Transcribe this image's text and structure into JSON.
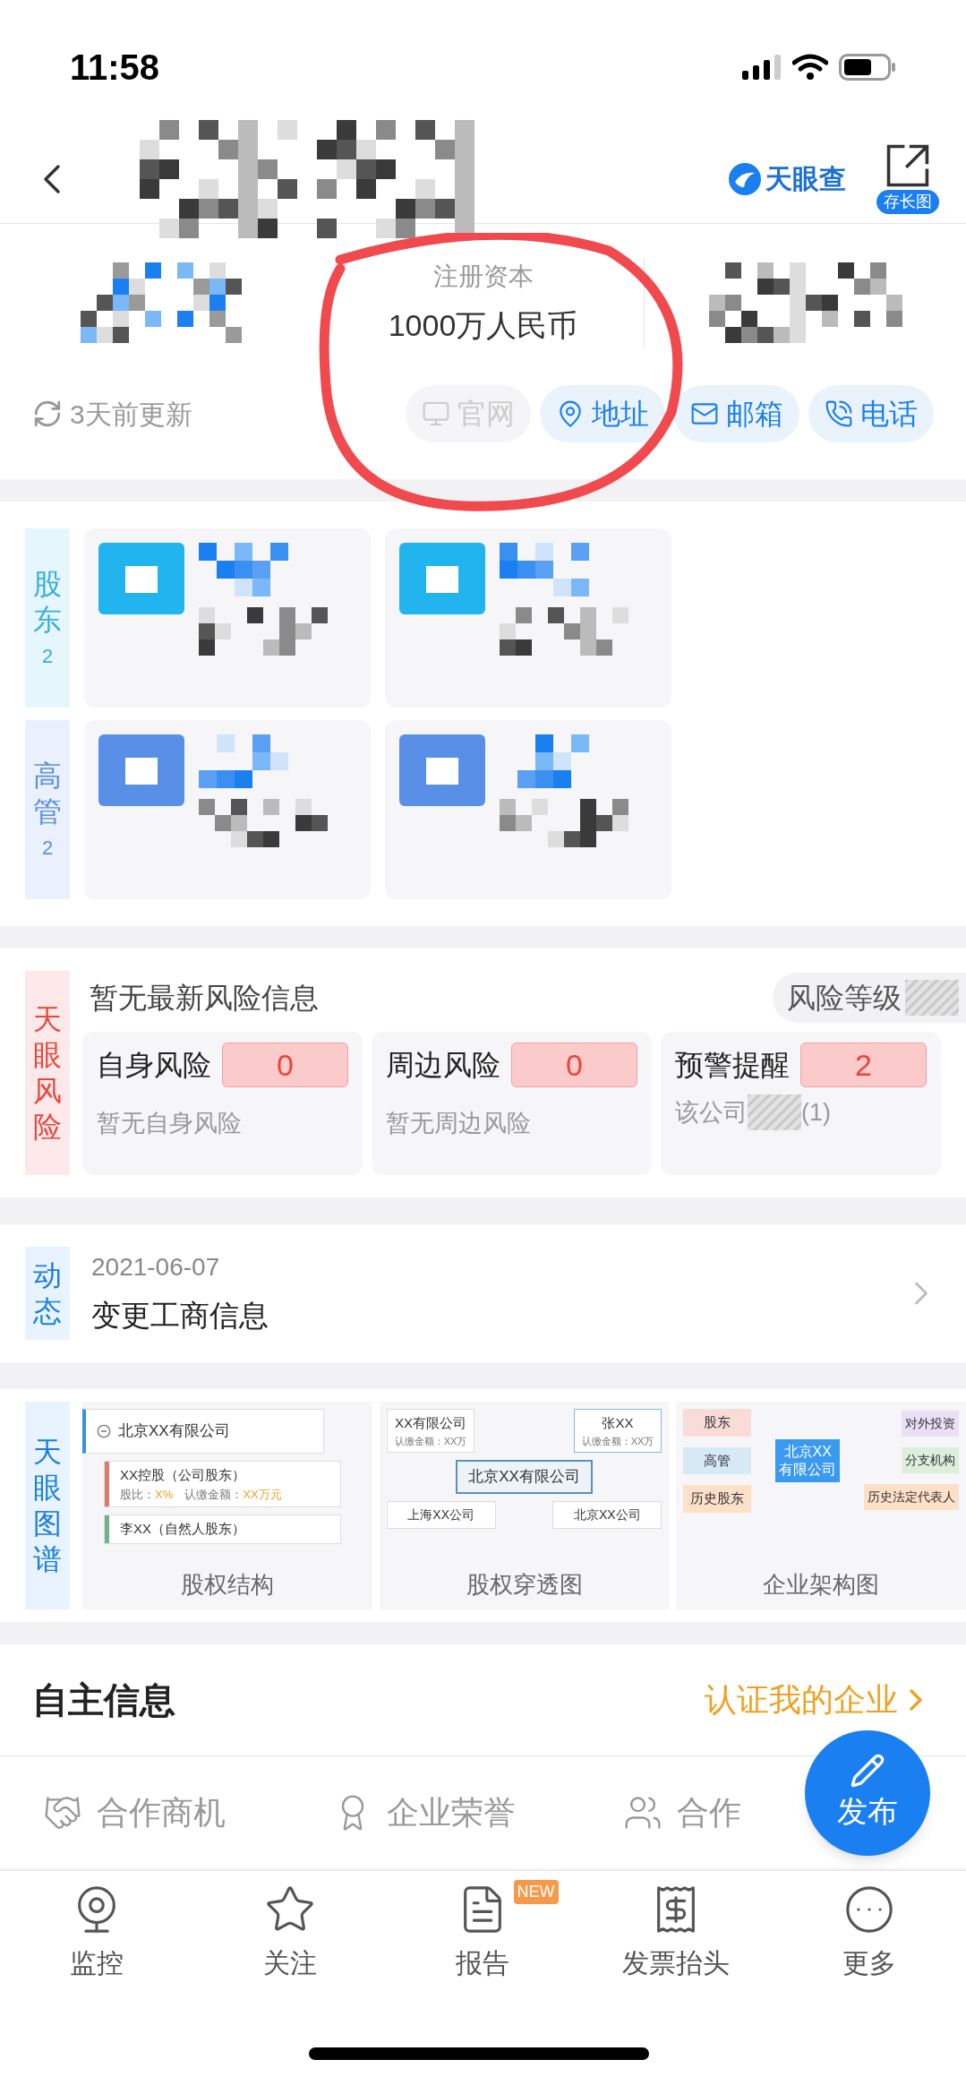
{
  "status_bar": {
    "time": "11:58"
  },
  "header": {
    "logo_text": "天眼查",
    "save_label": "存长图"
  },
  "capital": {
    "label": "注册资本",
    "value": "1000万人民币"
  },
  "update_text": "3天前更新",
  "actions": [
    {
      "label": "官网",
      "disabled": true
    },
    {
      "label": "地址",
      "disabled": false
    },
    {
      "label": "邮箱",
      "disabled": false
    },
    {
      "label": "电话",
      "disabled": false
    }
  ],
  "people": [
    {
      "title": "股东",
      "count": "2",
      "color": "#3aaee0"
    },
    {
      "title": "高管",
      "count": "2",
      "color": "#5a8fe0"
    }
  ],
  "risk": {
    "side_label": "天眼风险",
    "summary": "暂无最新风险信息",
    "level_label": "风险等级",
    "cards": [
      {
        "kind": "plain",
        "title": "自身风险",
        "count": "0",
        "note": "暂无自身风险"
      },
      {
        "kind": "plain",
        "title": "周边风险",
        "count": "0",
        "note": "暂无周边风险"
      },
      {
        "kind": "masked",
        "title": "预警提醒",
        "count": "2",
        "note": "该公司",
        "note_suffix": "(1)"
      }
    ]
  },
  "dynamics": {
    "side_label": "动态",
    "date": "2021-06-07",
    "text": "变更工商信息"
  },
  "graphs": {
    "side_label": "天眼图谱",
    "items": [
      {
        "kind": "structure",
        "caption": "股权结构",
        "root": "北京XX有限公司",
        "children": [
          {
            "name": "XX控股（公司股东）",
            "ratio_label": "股比：",
            "ratio": "X%",
            "amount_label": "认缴金额：",
            "amount": "XX万元",
            "color": "#e07a6e"
          },
          {
            "name": "李XX（自然人股东）",
            "color": "#6fb58a"
          }
        ]
      },
      {
        "kind": "penetration",
        "caption": "股权穿透图",
        "top": [
          {
            "name": "XX有限公司",
            "amount": "认缴金额：XX万"
          },
          {
            "name": "张XX",
            "amount": "认缴金额：XX万"
          }
        ],
        "center": "北京XX有限公司",
        "bottom": [
          "上海XX公司",
          "北京XX公司"
        ]
      },
      {
        "kind": "org",
        "caption": "企业架构图",
        "center": [
          "北京XX",
          "有限公司"
        ],
        "left": [
          {
            "label": "股东",
            "color": "#f9dcd8"
          },
          {
            "label": "高管",
            "color": "#d6e9f5"
          },
          {
            "label": "历史股东",
            "color": "#fde0c8"
          }
        ],
        "right": [
          {
            "label": "对外投资",
            "color": "#eadff5"
          },
          {
            "label": "分支机构",
            "color": "#dcefdc"
          },
          {
            "label": "历史法定代表人",
            "color": "#fde0c8"
          }
        ]
      }
    ]
  },
  "self_info": {
    "title": "自主信息",
    "link": "认证我的企业",
    "features": [
      "合作商机",
      "企业荣誉",
      "合作"
    ],
    "fab": "发布"
  },
  "tab_bar": [
    {
      "label": "监控"
    },
    {
      "label": "关注"
    },
    {
      "label": "报告",
      "badge": "NEW"
    },
    {
      "label": "发票抬头"
    },
    {
      "label": "更多"
    }
  ]
}
